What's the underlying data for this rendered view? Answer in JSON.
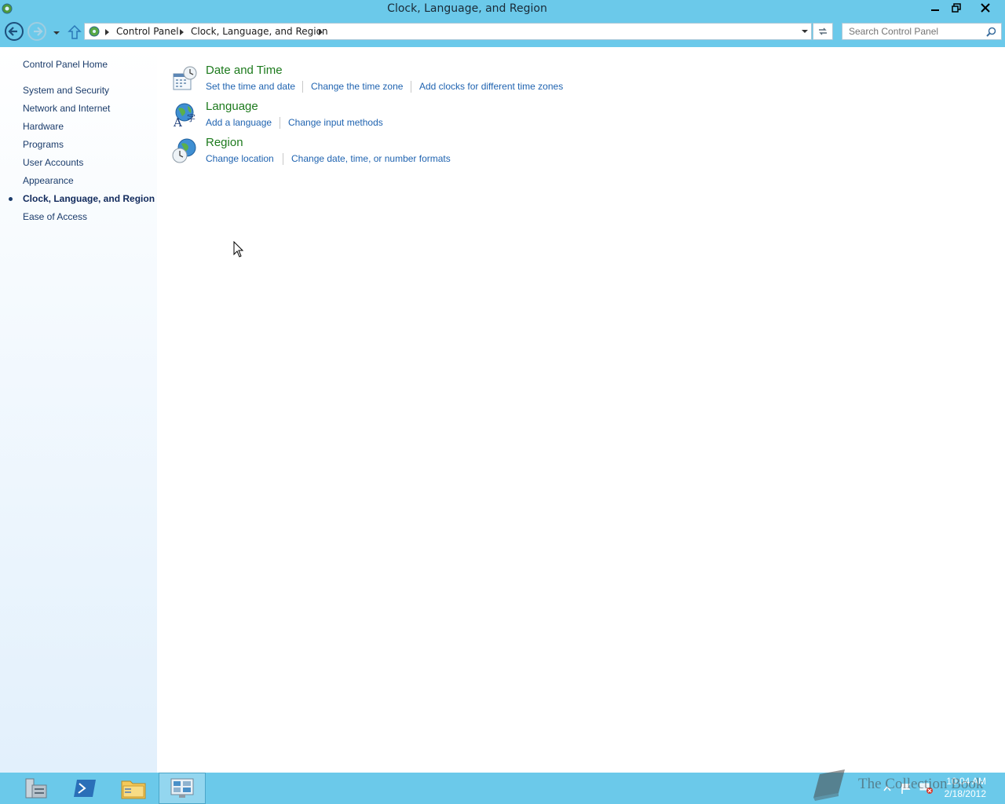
{
  "window": {
    "title": "Clock, Language, and Region"
  },
  "address_bar": {
    "crumbs": [
      "Control Panel",
      "Clock, Language, and Region"
    ]
  },
  "search": {
    "placeholder": "Search Control Panel"
  },
  "sidebar": {
    "home": "Control Panel Home",
    "items": [
      {
        "label": "System and Security"
      },
      {
        "label": "Network and Internet"
      },
      {
        "label": "Hardware"
      },
      {
        "label": "Programs"
      },
      {
        "label": "User Accounts"
      },
      {
        "label": "Appearance"
      },
      {
        "label": "Clock, Language, and Region",
        "active": true
      },
      {
        "label": "Ease of Access"
      }
    ]
  },
  "categories": [
    {
      "title": "Date and Time",
      "icon": "calendar-clock-icon",
      "tasks": [
        "Set the time and date",
        "Change the time zone",
        "Add clocks for different time zones"
      ]
    },
    {
      "title": "Language",
      "icon": "globe-language-icon",
      "tasks": [
        "Add a language",
        "Change input methods"
      ]
    },
    {
      "title": "Region",
      "icon": "globe-clock-icon",
      "tasks": [
        "Change location",
        "Change date, time, or number formats"
      ]
    }
  ],
  "taskbar": {
    "buttons": [
      "server-manager-icon",
      "powershell-icon",
      "file-explorer-icon",
      "control-panel-icon"
    ],
    "time": "10:04 AM",
    "date": "2/18/2012"
  },
  "watermark": "The Collection Book",
  "colors": {
    "chrome": "#6bc9ea",
    "category_title": "#1d7a1d",
    "task_link": "#1f63b0",
    "sidebar_link": "#1b3c6b"
  }
}
